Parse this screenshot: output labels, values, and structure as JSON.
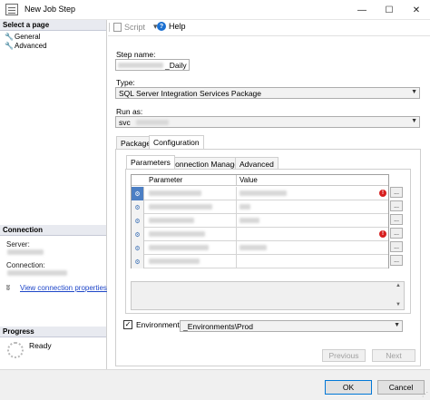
{
  "window": {
    "title": "New Job Step",
    "minimize": "—",
    "maximize": "☐",
    "close": "✕"
  },
  "left_panel": {
    "select_page_header": "Select a page",
    "pages": [
      {
        "label": "General",
        "icon": "wrench-icon"
      },
      {
        "label": "Advanced",
        "icon": "wrench-icon"
      }
    ],
    "connection_header": "Connection",
    "server_label": "Server:",
    "connection_label": "Connection:",
    "view_connection_link": "View connection properties",
    "progress_header": "Progress",
    "progress_status": "Ready"
  },
  "toolbar": {
    "script_label": "Script",
    "script_dropdown": "▾",
    "help_label": "Help"
  },
  "form": {
    "step_name_label": "Step name:",
    "step_name_value": "_Daily",
    "type_label": "Type:",
    "type_value": "SQL Server Integration Services Package",
    "run_as_label": "Run as:",
    "run_as_value": "svc"
  },
  "tabs": {
    "outer": [
      "Package",
      "Configuration"
    ],
    "outer_active": "Configuration",
    "inner": [
      "Parameters",
      "Connection Managers",
      "Advanced"
    ],
    "inner_active": "Parameters"
  },
  "grid": {
    "columns": [
      "Parameter",
      "Value"
    ],
    "rows": [
      {
        "error": true,
        "selected": true
      },
      {
        "error": false,
        "selected": false
      },
      {
        "error": false,
        "selected": false
      },
      {
        "error": true,
        "selected": false
      },
      {
        "error": false,
        "selected": false
      },
      {
        "error": false,
        "selected": false
      }
    ],
    "ellipsis": "..."
  },
  "environment": {
    "checked": true,
    "label": "Environment:",
    "value": "_Environments\\Prod"
  },
  "buttons": {
    "previous": "Previous",
    "next": "Next",
    "ok": "OK",
    "cancel": "Cancel"
  }
}
